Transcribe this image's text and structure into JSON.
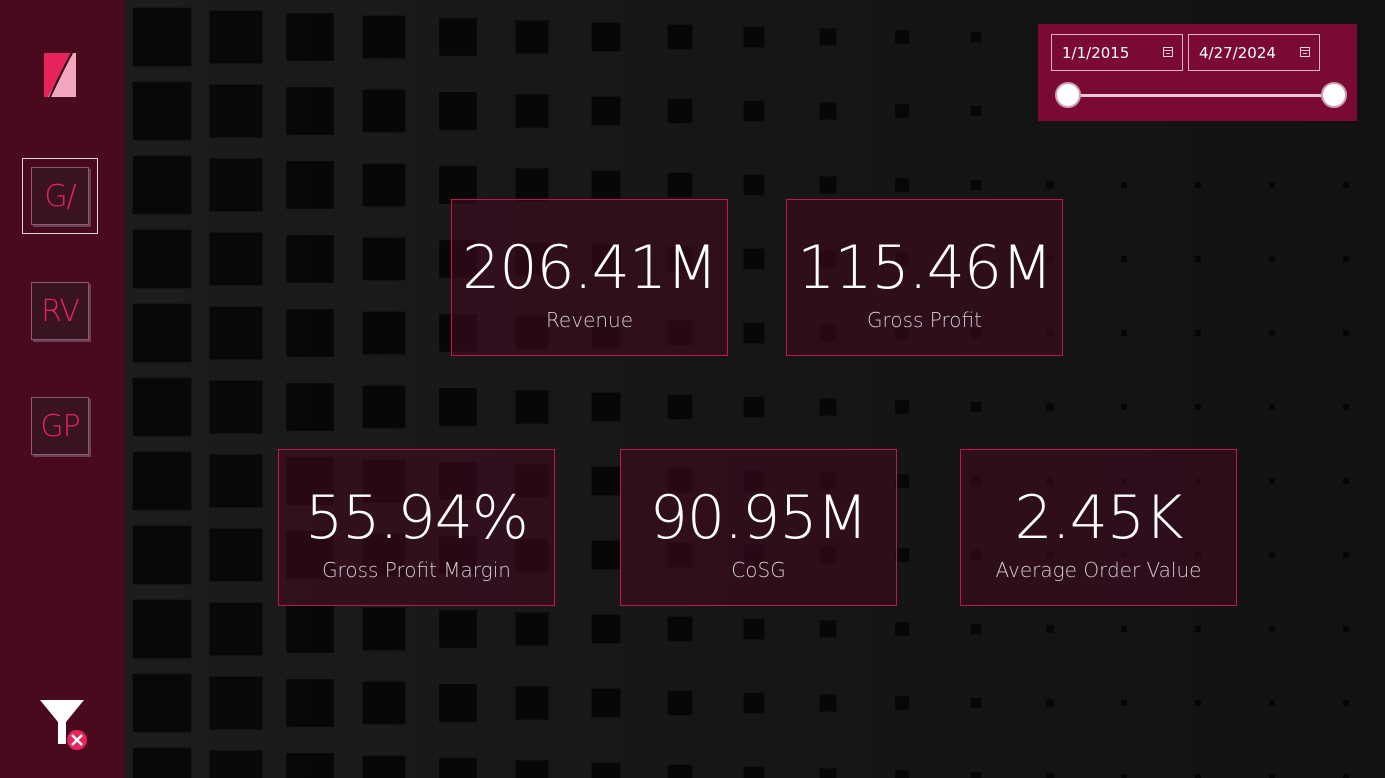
{
  "sidebar": {
    "logo_icon": "brand-logo-icon",
    "nav": [
      {
        "label": "G/",
        "icon": "overview-nav-icon"
      },
      {
        "label": "RV",
        "icon": "revenue-nav-icon"
      },
      {
        "label": "GP",
        "icon": "gross-profit-nav-icon"
      }
    ],
    "clear_filters_icon": "clear-filters-icon"
  },
  "date_slicer": {
    "start": "1/1/2015",
    "end": "4/27/2024",
    "range_start_fraction": 0,
    "range_end_fraction": 1
  },
  "kpis": {
    "revenue": {
      "value": "206.41M",
      "label": "Revenue"
    },
    "gross_profit": {
      "value": "115.46M",
      "label": "Gross Profit"
    },
    "gross_profit_margin": {
      "value": "55.94%",
      "label": "Gross Profit Margin"
    },
    "cosg": {
      "value": "90.95M",
      "label": "CoSG"
    },
    "average_order_value": {
      "value": "2.45K",
      "label": "Average Order Value"
    }
  },
  "colors": {
    "sidebar": "#4a0a1e",
    "accent": "#c0164a",
    "slicer": "#7a0a33",
    "logo_pink": "#e6235a",
    "logo_light": "#f3a6c0"
  }
}
